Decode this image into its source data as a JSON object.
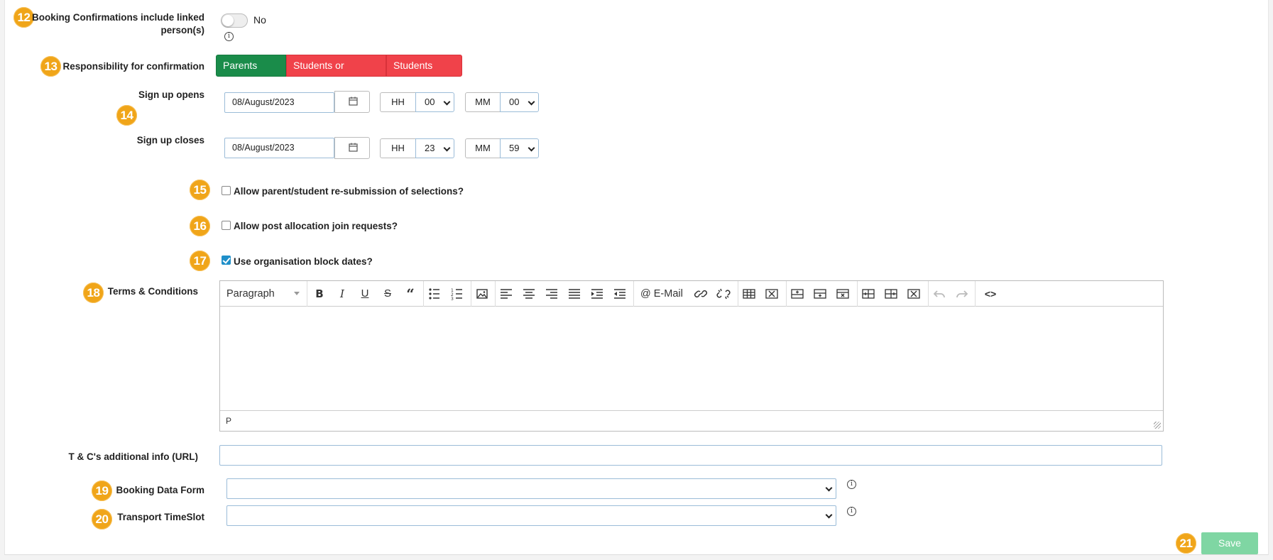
{
  "row12": {
    "badge": "12",
    "label_line1": "Booking Confirmations include linked",
    "label_line2": "person(s)",
    "toggle_value": "No",
    "info_icon": "info-icon"
  },
  "row13": {
    "badge": "13",
    "label": "Responsibility for confirmation",
    "options": [
      "Parents Only",
      "Students or Parents",
      "Students Only"
    ],
    "selected": "Parents Only",
    "colors": {
      "selected": "#1a8c4a",
      "unselected": "#f0424a"
    }
  },
  "row14": {
    "badge": "14",
    "opens": {
      "label": "Sign up opens",
      "date": "08/August/2023",
      "hh_label": "HH",
      "hh": "00",
      "mm_label": "MM",
      "mm": "00"
    },
    "closes": {
      "label": "Sign up closes",
      "date": "08/August/2023",
      "hh_label": "HH",
      "hh": "23",
      "mm_label": "MM",
      "mm": "59"
    }
  },
  "row15": {
    "badge": "15",
    "label": "Allow parent/student re-submission of selections?",
    "checked": false
  },
  "row16": {
    "badge": "16",
    "label": "Allow post allocation join requests?",
    "checked": false
  },
  "row17": {
    "badge": "17",
    "label": "Use organisation block dates?",
    "checked": true
  },
  "row18": {
    "badge": "18",
    "label": "Terms & Conditions",
    "editor": {
      "block_format": "Paragraph",
      "email_label": "E-Mail",
      "status_path": "P",
      "content": ""
    }
  },
  "tc_url": {
    "label": "T & C's additional info (URL)",
    "value": ""
  },
  "row19": {
    "badge": "19",
    "label": "Booking Data Form",
    "value": ""
  },
  "row20": {
    "badge": "20",
    "label": "Transport TimeSlot",
    "value": ""
  },
  "row21": {
    "badge": "21",
    "save_label": "Save"
  },
  "colors": {
    "badge": "#f0a519",
    "save": "#7fd6a3",
    "input_border": "#9bbcd8"
  }
}
